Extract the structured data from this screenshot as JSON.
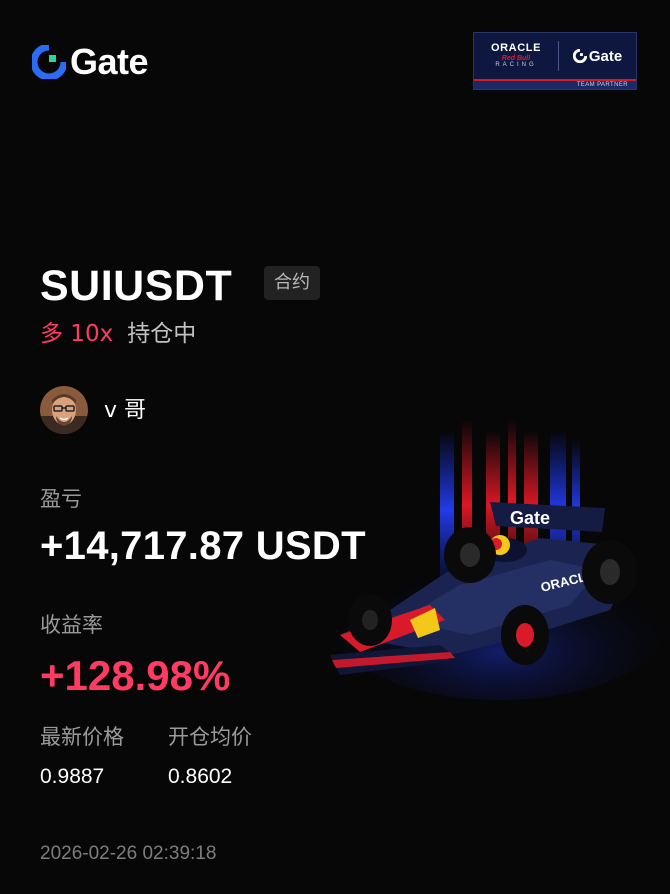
{
  "brand": {
    "name": "Gate",
    "color": "#2a6cf6"
  },
  "partner": {
    "oracle": "ORACLE",
    "redbull": "Red Bull",
    "racing": "RACING",
    "gate": "Gate",
    "caption": "TEAM PARTNER",
    "background": "#0d1740",
    "accent": "#d71920"
  },
  "position": {
    "pair": "SUIUSDT",
    "type_tag": "合约",
    "side": "多 10x",
    "status": "持仓中",
    "side_color": "#ff3b63"
  },
  "user": {
    "name": "v 哥",
    "avatar_icon": "user-avatar"
  },
  "pnl": {
    "label": "盈亏",
    "value": "+14,717.87 USDT"
  },
  "roi": {
    "label": "收益率",
    "value": "+128.98%",
    "color": "#ff3b63"
  },
  "prices": {
    "latest_label": "最新价格",
    "latest_value": "0.9887",
    "open_label": "开仓均价",
    "open_value": "0.8602"
  },
  "timestamp": "2026-02-26 02:39:18",
  "art": {
    "car_wing_text": "Gate",
    "car_side_text": "ORACLE"
  }
}
